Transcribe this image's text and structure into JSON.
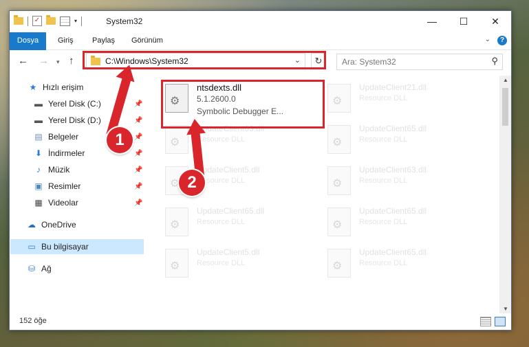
{
  "window": {
    "title": "System32"
  },
  "ribbon": {
    "tabs": [
      "Dosya",
      "Giriş",
      "Paylaş",
      "Görünüm"
    ]
  },
  "address": {
    "path": "C:\\Windows\\System32"
  },
  "search": {
    "placeholder": "Ara: System32"
  },
  "sidebar": {
    "items": [
      {
        "label": "Hızlı erişim",
        "icon": "star-icon"
      },
      {
        "label": "Yerel Disk (C:)",
        "icon": "drive-icon",
        "pinned": true
      },
      {
        "label": "Yerel Disk (D:)",
        "icon": "drive-icon",
        "pinned": true
      },
      {
        "label": "Belgeler",
        "icon": "document-icon",
        "pinned": true
      },
      {
        "label": "İndirmeler",
        "icon": "download-icon",
        "pinned": true
      },
      {
        "label": "Müzik",
        "icon": "music-icon",
        "pinned": true
      },
      {
        "label": "Resimler",
        "icon": "pictures-icon",
        "pinned": true
      },
      {
        "label": "Videolar",
        "icon": "video-icon",
        "pinned": true
      },
      {
        "label": "OneDrive",
        "icon": "cloud-icon"
      },
      {
        "label": "Bu bilgisayar",
        "icon": "computer-icon",
        "selected": true
      },
      {
        "label": "Ağ",
        "icon": "network-icon"
      }
    ]
  },
  "files": [
    {
      "name": "ntsdexts.dll",
      "version": "5.1.2600.0",
      "desc": "Symbolic Debugger E..."
    },
    {
      "name": "UpdateClient21.dll",
      "desc": "Resource DLL"
    },
    {
      "name": "UpdateClient63.dll",
      "desc": "Resource DLL"
    },
    {
      "name": "UpdateClient65.dll",
      "desc": "Resource DLL"
    },
    {
      "name": "UpdateClient5.dll",
      "desc": "Resource DLL"
    },
    {
      "name": "UpdateClient63.dll",
      "desc": "Resource DLL"
    },
    {
      "name": "UpdateClient65.dll",
      "desc": "Resource DLL"
    },
    {
      "name": "UpdateClient65.dll",
      "desc": "Resource DLL"
    },
    {
      "name": "UpdateClient5.dll",
      "desc": "Resource DLL"
    },
    {
      "name": "UpdateClient65.dll",
      "desc": "Resource DLL"
    }
  ],
  "status": {
    "count": "152 öğe"
  },
  "annotations": {
    "step1": "1",
    "step2": "2",
    "color": "#d9262c"
  }
}
